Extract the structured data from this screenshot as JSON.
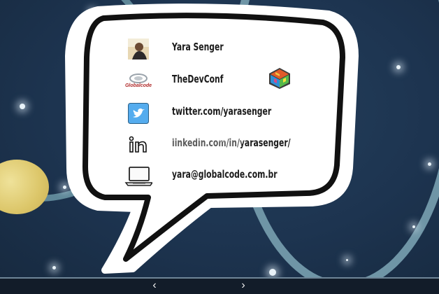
{
  "contacts": [
    {
      "label": "Yara Senger",
      "icon": "profile-photo"
    },
    {
      "label": "TheDevConf",
      "icon": "globalcode-logo",
      "brand_text": "Globalcode"
    },
    {
      "label": "twitter.com/yarasenger",
      "icon": "twitter-icon"
    },
    {
      "label": "linkedin.com/in/yarasenger/",
      "icon": "linkedin-icon"
    },
    {
      "label": "yara@globalcode.com.br",
      "icon": "laptop-icon"
    }
  ],
  "nav": {
    "prev": "‹",
    "next": "›"
  },
  "colors": {
    "background": "#1d3450",
    "ring": "#6f95a6",
    "bubble_fill": "#ffffff",
    "bubble_outline": "#111111",
    "moon": "#dcc669",
    "twitter": "#55acee"
  }
}
